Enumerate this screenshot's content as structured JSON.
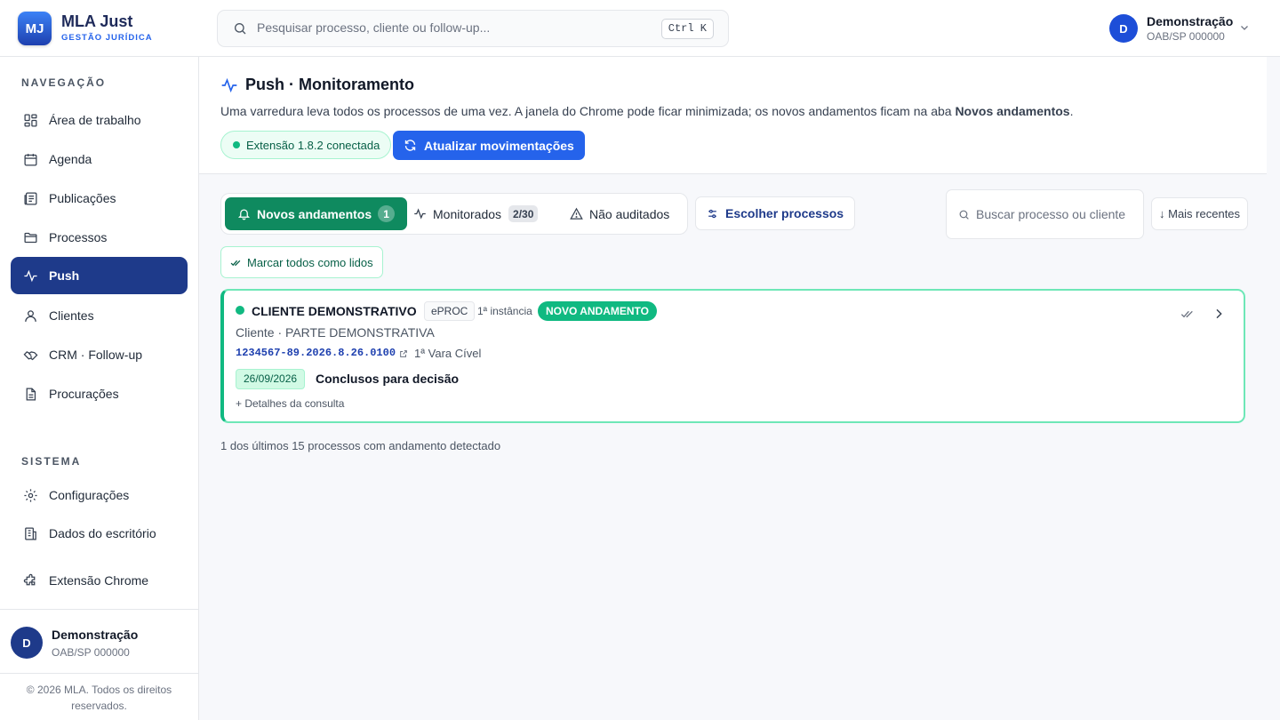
{
  "brand": {
    "logo_text": "MJ",
    "name": "MLA Just",
    "subtitle": "GESTÃO JURÍDICA"
  },
  "search": {
    "placeholder": "Pesquisar processo, cliente ou follow-up...",
    "shortcut": "Ctrl K"
  },
  "user": {
    "initial": "D",
    "name": "Demonstração",
    "oab": "OAB/SP 000000"
  },
  "sidebar": {
    "nav_title": "NAVEGAÇÃO",
    "items": [
      {
        "label": "Área de trabalho",
        "icon": "grid-icon"
      },
      {
        "label": "Agenda",
        "icon": "calendar-icon"
      },
      {
        "label": "Publicações",
        "icon": "newspaper-icon"
      },
      {
        "label": "Processos",
        "icon": "folder-icon"
      },
      {
        "label": "Push",
        "icon": "activity-icon",
        "active": true
      },
      {
        "label": "Clientes",
        "icon": "user-icon"
      },
      {
        "label": "CRM · Follow-up",
        "icon": "handshake-icon"
      },
      {
        "label": "Procurações",
        "icon": "document-icon"
      }
    ],
    "system_title": "SISTEMA",
    "system_items": [
      {
        "label": "Configurações",
        "icon": "gear-icon"
      },
      {
        "label": "Dados do escritório",
        "icon": "building-icon"
      },
      {
        "label": "Extensão Chrome",
        "icon": "puzzle-icon"
      }
    ],
    "copyright": "© 2026 MLA. Todos os direitos reservados."
  },
  "header": {
    "title": "Push · Monitoramento",
    "desc_prefix": "Uma varredura leva todos os processos de uma vez. A janela do Chrome pode ficar minimizada; os novos andamentos ficam na aba ",
    "desc_bold": "Novos andamentos",
    "desc_suffix": ".",
    "extension_status": "Extensão 1.8.2 conectada",
    "refresh_button": "Atualizar movimentações"
  },
  "tabs": [
    {
      "label": "Novos andamentos",
      "count": "1",
      "active": true
    },
    {
      "label": "Monitorados",
      "count": "2/30"
    },
    {
      "label": "Não auditados"
    }
  ],
  "toolbar": {
    "choose_button": "Escolher processos",
    "search_placeholder": "Buscar processo ou cliente",
    "sort_label": "↓ Mais recentes",
    "mark_read": "Marcar todos como lidos"
  },
  "card": {
    "client": "CLIENTE DEMONSTRATIVO",
    "system": "ePROC",
    "instance": "1ª instância",
    "badge": "NOVO ANDAMENTO",
    "role": "Cliente · PARTE DEMONSTRATIVA",
    "process_number": "1234567-89.2026.8.26.0100",
    "court": "1ª Vara Cível",
    "date": "26/09/2026",
    "movement": "Conclusos para decisão",
    "details": "+ Detalhes da consulta"
  },
  "footer_count": "1 dos últimos 15 processos com andamento detectado",
  "colors": {
    "primary": "#2563eb",
    "navy": "#1e3a8a",
    "green": "#10b981",
    "green_dark": "#0f8a5f"
  }
}
